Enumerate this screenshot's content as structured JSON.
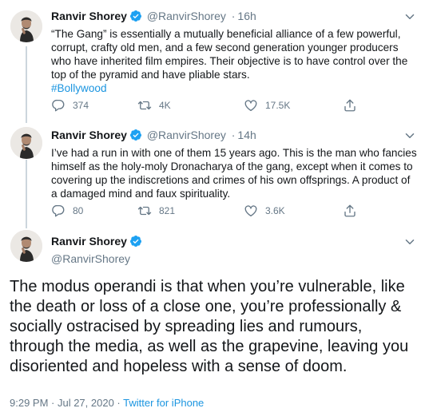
{
  "tweets": [
    {
      "name": "Ranvir Shorey",
      "handle": "@RanvirShorey",
      "separator": "·",
      "time": "16h",
      "text": "“The Gang” is essentially a mutually beneficial alliance of a few powerful, corrupt, crafty old men, and a few second generation younger producers who have inherited film empires. Their objective is to have control over the top of the pyramid and have pliable stars.",
      "hashtag": "#Bollywood",
      "replies": "374",
      "retweets": "4K",
      "likes": "17.5K"
    },
    {
      "name": "Ranvir Shorey",
      "handle": "@RanvirShorey",
      "separator": "·",
      "time": "14h",
      "text": "I’ve had a run in with one of them 15 years ago. This is the man who fancies himself as the holy-moly Dronacharya of the gang, except when it comes to covering up the indiscretions and crimes of his own offsprings. A product of a damaged mind and faux spirituality.",
      "replies": "80",
      "retweets": "821",
      "likes": "3.6K"
    }
  ],
  "main_tweet": {
    "name": "Ranvir Shorey",
    "handle": "@RanvirShorey",
    "text": "The modus operandi is that when you’re vulnerable, like the death or loss of a close one, you’re professionally & socially ostracised by spreading lies and rumours, through the media, as well as the grapevine, leaving you disoriented and hopeless with a sense of doom.",
    "timestamp": "9:29 PM · Jul 27, 2020 · ",
    "source": "Twitter for iPhone"
  },
  "icons": {
    "reply": "reply-icon",
    "retweet": "retweet-icon",
    "like": "heart-icon",
    "share": "share-icon",
    "verified": "verified-badge-icon",
    "more": "chevron-down-icon"
  },
  "colors": {
    "link": "#1b95e0",
    "verified": "#1da1f2",
    "muted": "#657786",
    "thread_line": "#ccd6dd"
  }
}
